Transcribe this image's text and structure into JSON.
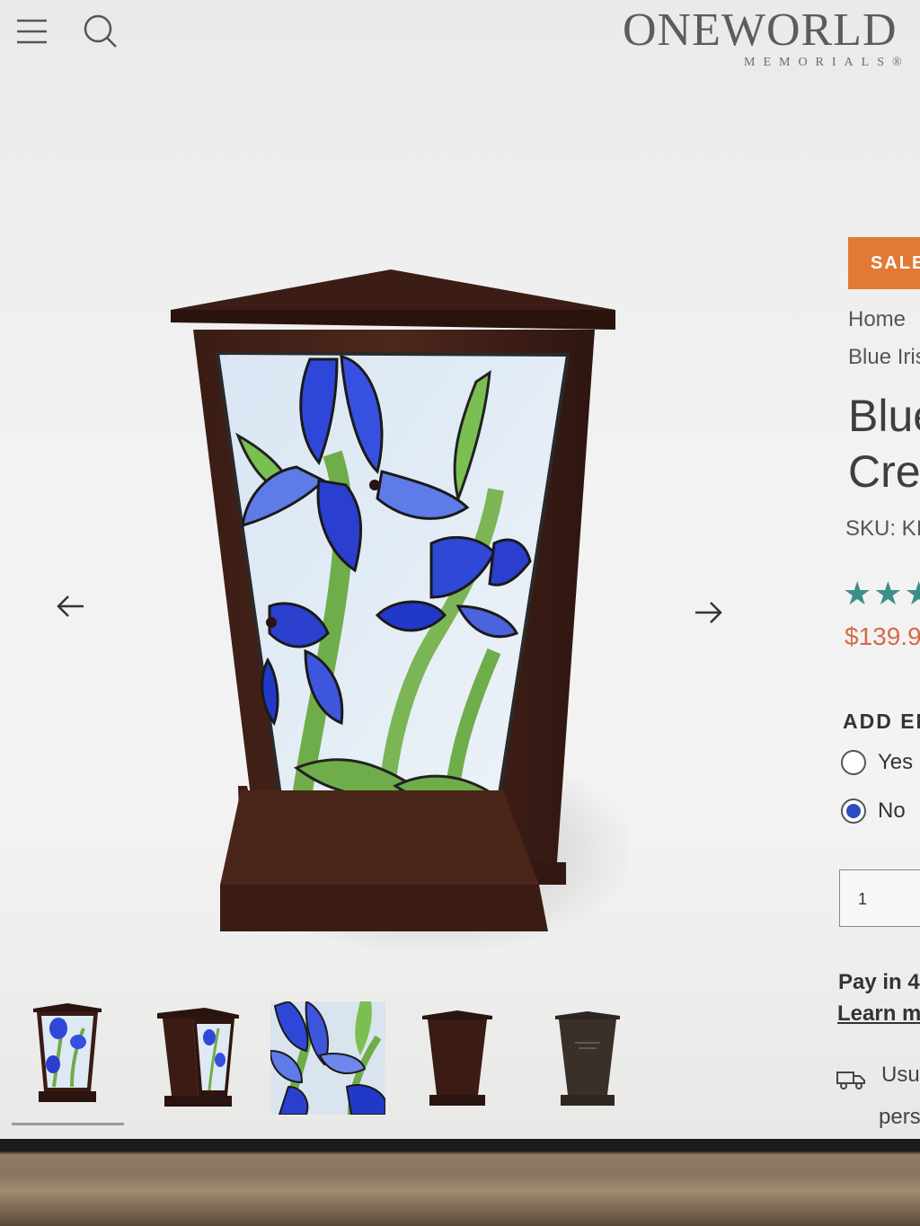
{
  "header": {
    "menu_icon": "hamburger-menu-icon",
    "search_icon": "search-icon",
    "logo_main": "ONEWORLD",
    "logo_sub": "MEMORIALS®"
  },
  "gallery": {
    "prev_icon": "arrow-left-icon",
    "next_icon": "arrow-right-icon",
    "thumbnails": [
      {
        "name": "thumbnail-front-view"
      },
      {
        "name": "thumbnail-angle-view"
      },
      {
        "name": "thumbnail-closeup-view"
      },
      {
        "name": "thumbnail-back-view"
      },
      {
        "name": "thumbnail-engraved-back-view"
      }
    ],
    "active_thumbnail": 0
  },
  "product": {
    "badge": "SALE",
    "breadcrumb_home": "Home",
    "breadcrumb_current": "Blue Iris",
    "title_line1": "Blue",
    "title_line2": "Crem",
    "sku": "SKU: KI",
    "rating_stars": "★★★",
    "price": "$139.9",
    "option_title": "ADD EN",
    "option_yes": "Yes (",
    "option_no": "No",
    "selected_option": "No",
    "quantity": "1",
    "pay_text": "Pay in 4",
    "learn_more": "Learn m",
    "shipping_icon": "truck-icon",
    "shipping_line1": "Usu",
    "shipping_line2": "pers"
  },
  "colors": {
    "sale_badge": "#e07a35",
    "price": "#d66a4a",
    "stars": "#3b8f8a",
    "radio_selected": "#2c4ec2"
  }
}
